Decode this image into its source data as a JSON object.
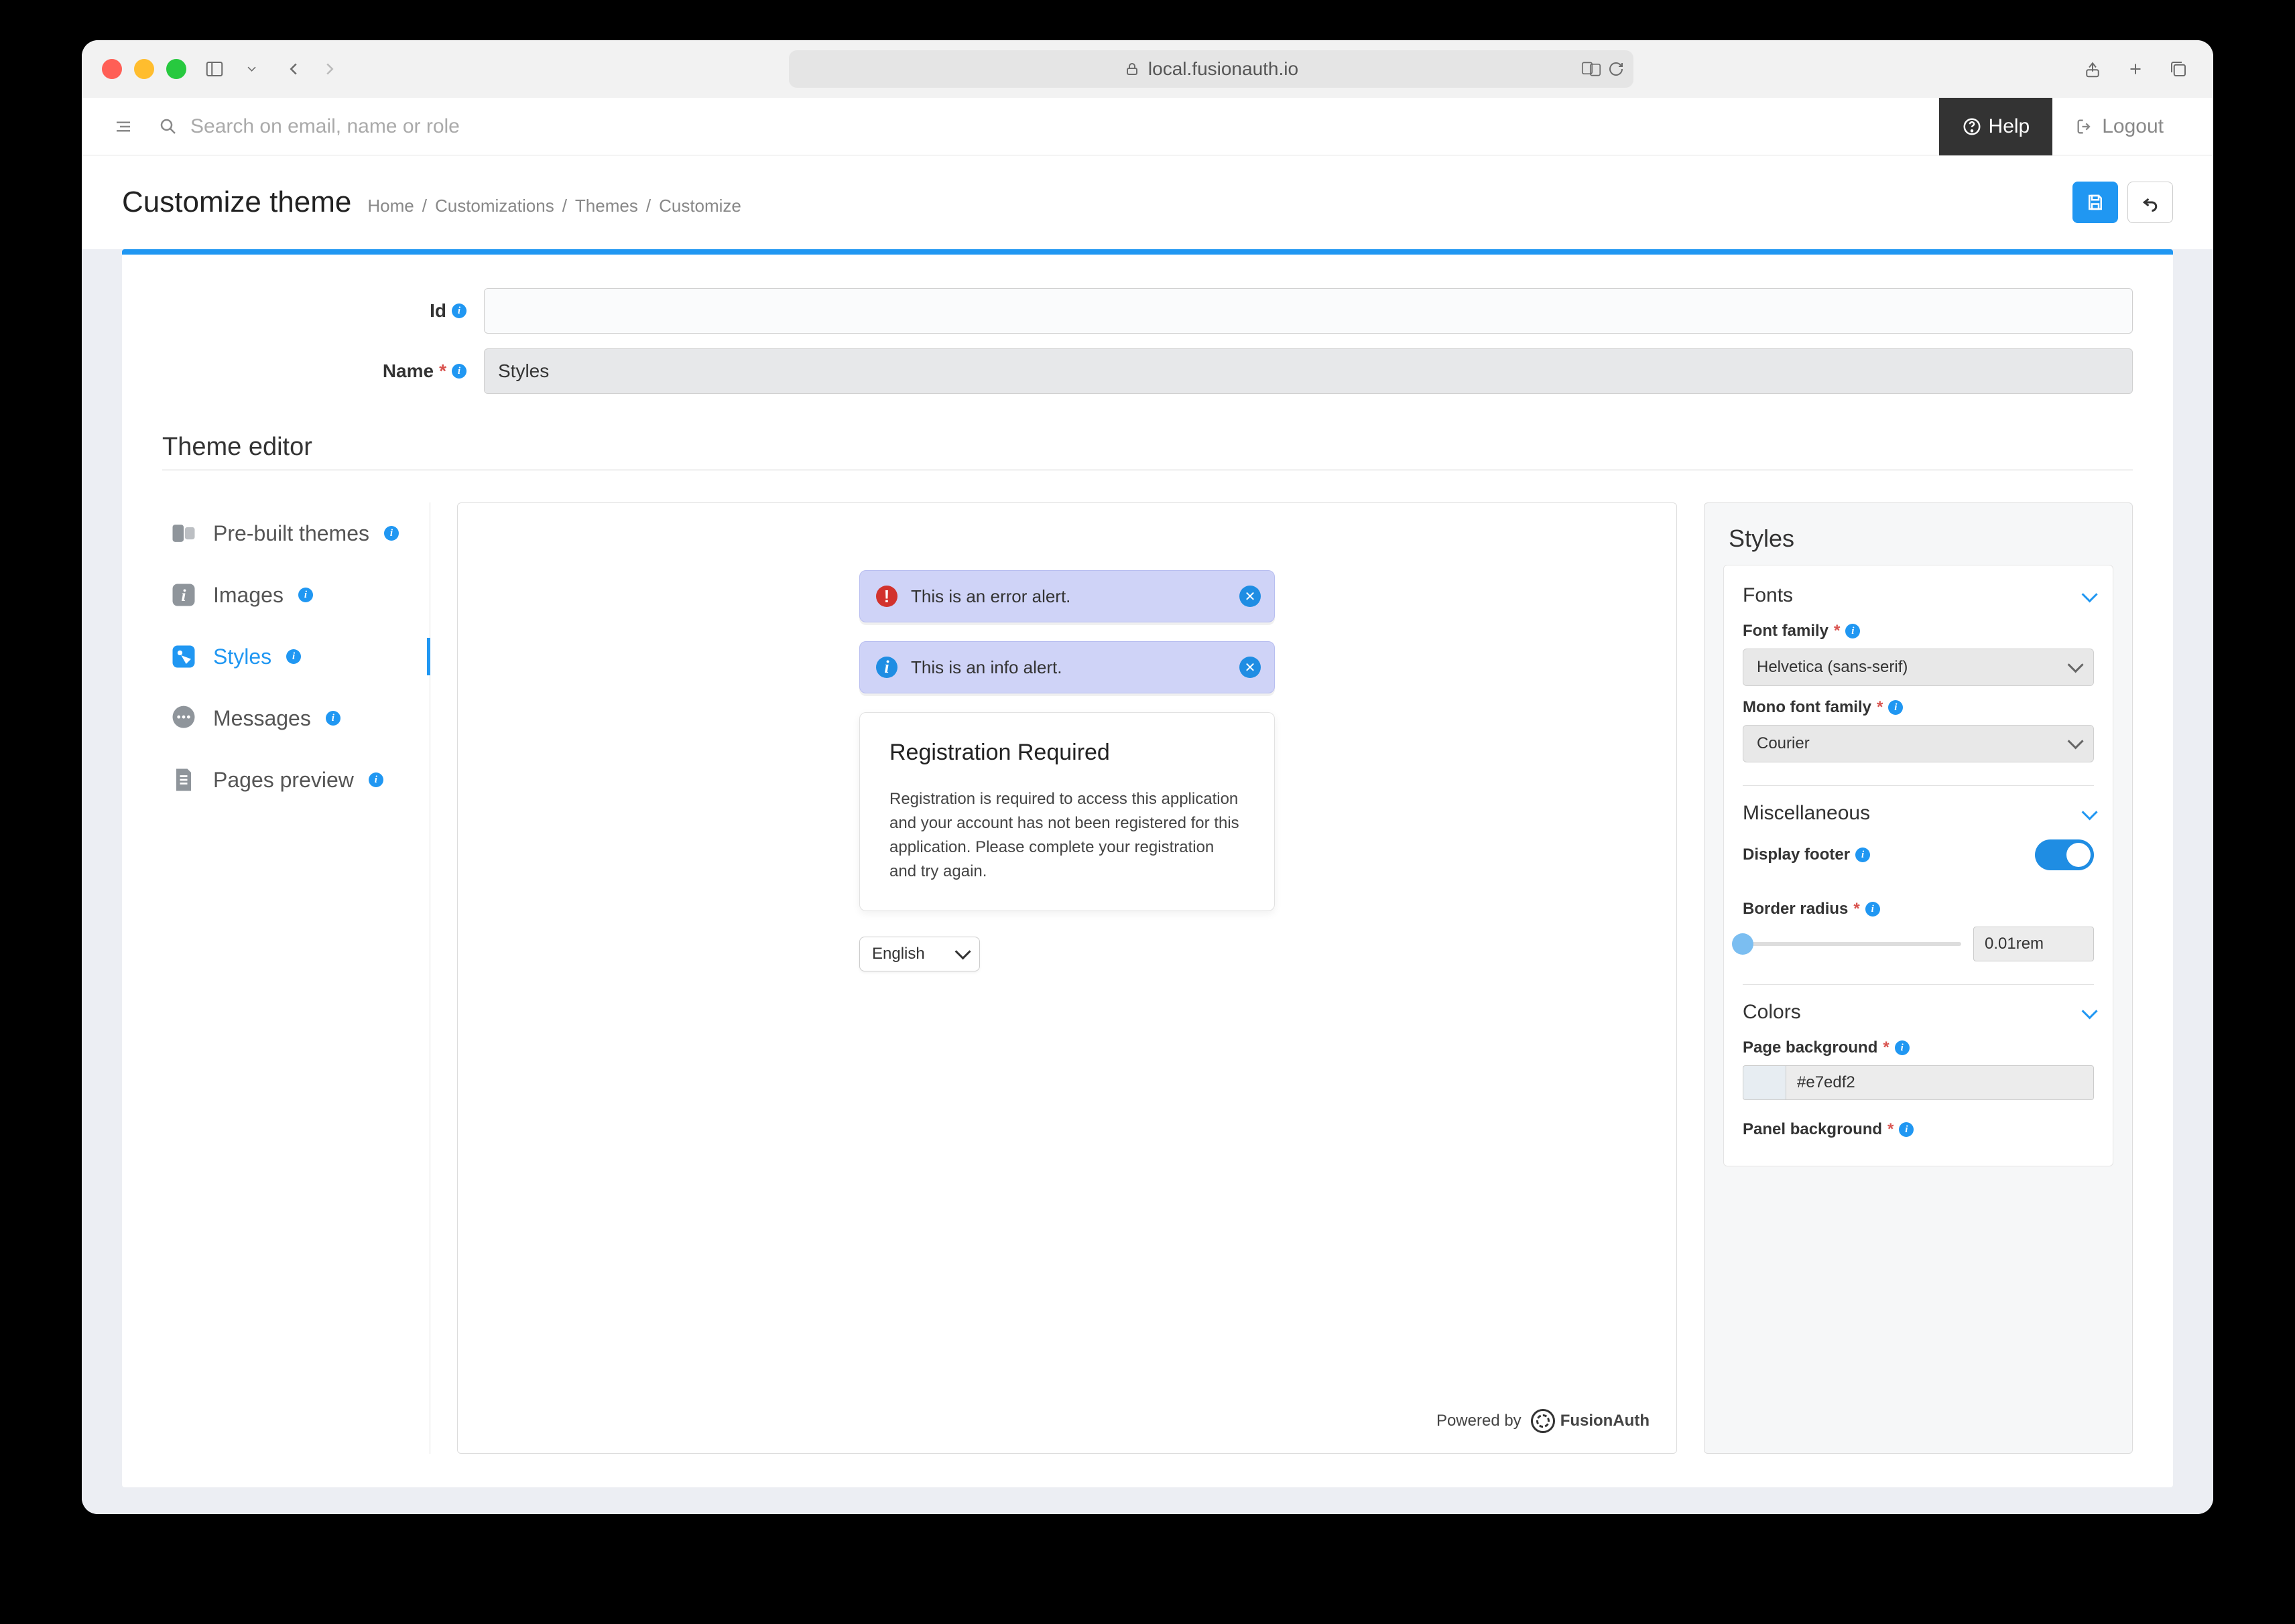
{
  "browser": {
    "url": "local.fusionauth.io"
  },
  "topbar": {
    "search_placeholder": "Search on email, name or role",
    "help": "Help",
    "logout": "Logout"
  },
  "header": {
    "title": "Customize theme",
    "crumbs": [
      "Home",
      "Customizations",
      "Themes",
      "Customize"
    ]
  },
  "form": {
    "id_label": "Id",
    "id_value": "",
    "name_label": "Name",
    "name_value": "Styles"
  },
  "section_title": "Theme editor",
  "sidebar_items": [
    {
      "label": "Pre-built themes"
    },
    {
      "label": "Images"
    },
    {
      "label": "Styles"
    },
    {
      "label": "Messages"
    },
    {
      "label": "Pages preview"
    }
  ],
  "preview": {
    "error_alert": "This is an error alert.",
    "info_alert": "This is an info alert.",
    "reg_title": "Registration Required",
    "reg_body": "Registration is required to access this application and your account has not been registered for this application. Please complete your registration and try again.",
    "language": "English",
    "powered_by": "Powered by",
    "brand": "FusionAuth"
  },
  "styles_panel": {
    "title": "Styles",
    "fonts_heading": "Fonts",
    "font_family_label": "Font family",
    "font_family_value": "Helvetica (sans-serif)",
    "mono_font_label": "Mono font family",
    "mono_font_value": "Courier",
    "misc_heading": "Miscellaneous",
    "display_footer_label": "Display footer",
    "border_radius_label": "Border radius",
    "border_radius_value": "0.01rem",
    "colors_heading": "Colors",
    "page_bg_label": "Page background",
    "page_bg_value": "#e7edf2",
    "panel_bg_label": "Panel background"
  }
}
